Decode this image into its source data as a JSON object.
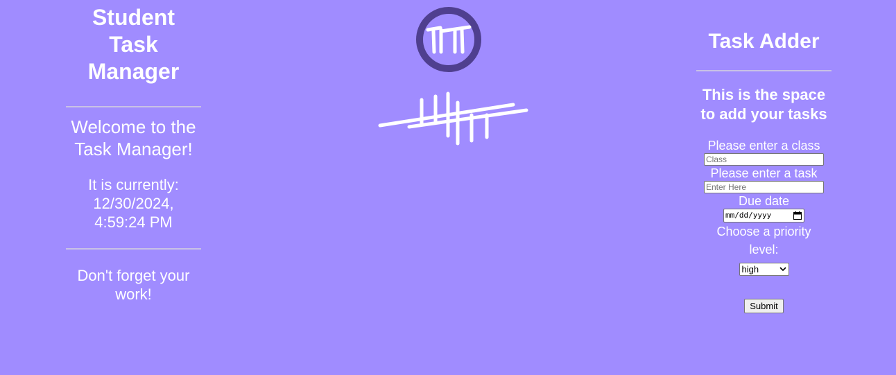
{
  "left": {
    "title": "Student Task Manager",
    "welcome": "Welcome to the Task Manager!",
    "clock": "It is currently: 12/30/2024, 4:59:24 PM",
    "reminder": "Don't forget your work!"
  },
  "logos": {
    "circle_logo_icon": "tm-circle-logo-icon",
    "strokes_logo_icon": "tm-strokes-logo-icon",
    "circle_ring_color": "#4f3f8f"
  },
  "right": {
    "title": "Task Adder",
    "subtitle": "This is the space to add your tasks",
    "class_label": "Please enter a class",
    "class_placeholder": "Class",
    "task_label": "Please enter a task",
    "task_placeholder": "Enter Here",
    "due_label": "Due date",
    "due_placeholder": "mm/dd/yyyy",
    "priority_label": "Choose a priority level:",
    "priority_selected": "high",
    "submit_label": "Submit"
  },
  "colors": {
    "background": "#a08cff",
    "text": "#ffffff"
  }
}
